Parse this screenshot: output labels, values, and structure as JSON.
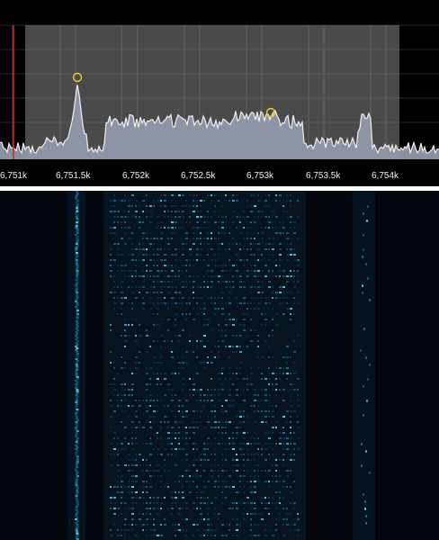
{
  "spectrum": {
    "frequency_labels": [
      "6,751k",
      "6,751.5k",
      "6,752k",
      "6,752.5k",
      "6,753k",
      "6,753.5k",
      "6,754k"
    ],
    "colors": {
      "background": "#000000",
      "passband": "#4a4a4a",
      "grid": "#7a7a7a",
      "trace": "#f1f1f1",
      "fill": "#8f98ab",
      "tuning_line": "#d71e1e",
      "marker": "#f3d22a"
    }
  },
  "waterfall": {
    "colors": {
      "background": "#02050a",
      "signal_low": "#0b3550",
      "signal_mid": "#1e6f93",
      "signal_high": "#5fe1ff"
    }
  }
}
